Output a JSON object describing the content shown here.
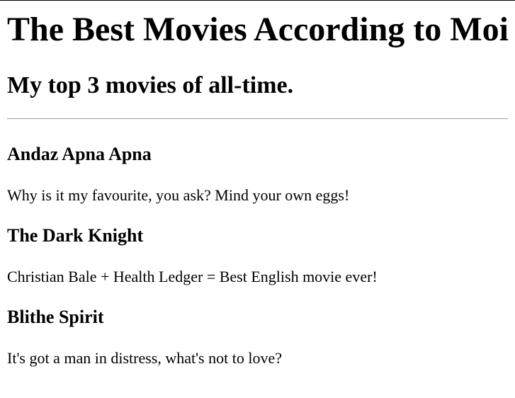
{
  "page": {
    "title": "The Best Movies According to Moi",
    "subtitle": "My top 3 movies of all-time."
  },
  "movies": [
    {
      "title": "Andaz Apna Apna",
      "description": "Why is it my favourite, you ask? Mind your own eggs!"
    },
    {
      "title": "The Dark Knight",
      "description": "Christian Bale + Health Ledger = Best English movie ever!"
    },
    {
      "title": "Blithe Spirit",
      "description": "It's got a man in distress, what's not to love?"
    }
  ]
}
